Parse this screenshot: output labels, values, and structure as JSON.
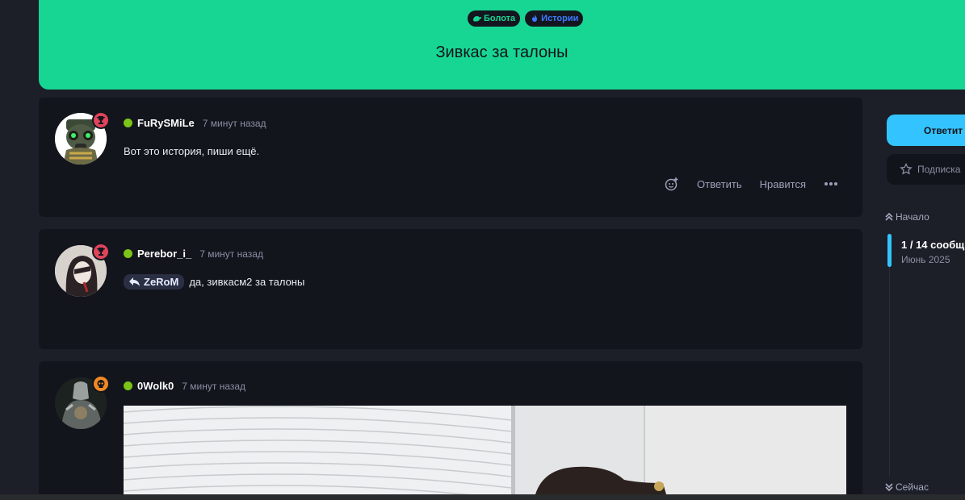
{
  "hero": {
    "tags": [
      {
        "label": "Болота",
        "icon": "frog-icon",
        "color": "#17d693"
      },
      {
        "label": "Истории",
        "icon": "fire-icon",
        "color": "#3b7bff"
      }
    ],
    "title": "Зивкас за талоны"
  },
  "posts": [
    {
      "username": "FuRySMiLe",
      "time": "7 минут назад",
      "badge": "trophy-icon",
      "text": "Вот это история, пиши ещё.",
      "actions": {
        "reply": "Ответить",
        "like": "Нравится"
      }
    },
    {
      "username": "Perebor_i_",
      "time": "7 минут назад",
      "badge": "trophy-icon",
      "reply_to": "ZeRoM",
      "text": "да, зивкасм2 за талоны"
    },
    {
      "username": "0Wolk0",
      "time": "7 минут назад",
      "badge": "skull-icon"
    }
  ],
  "sidebar": {
    "reply_button": "Ответит",
    "subscribe_button": "Подписка",
    "top_link": "Начало",
    "counter": "1 / 14 сообщ",
    "date": "Июнь 2025",
    "bottom_link": "Сейчас"
  },
  "colors": {
    "accent": "#17d693",
    "blue": "#33c4ff",
    "online": "#7cc518",
    "trophy_badge": "#e0445a",
    "skull_badge": "#f08a24"
  }
}
